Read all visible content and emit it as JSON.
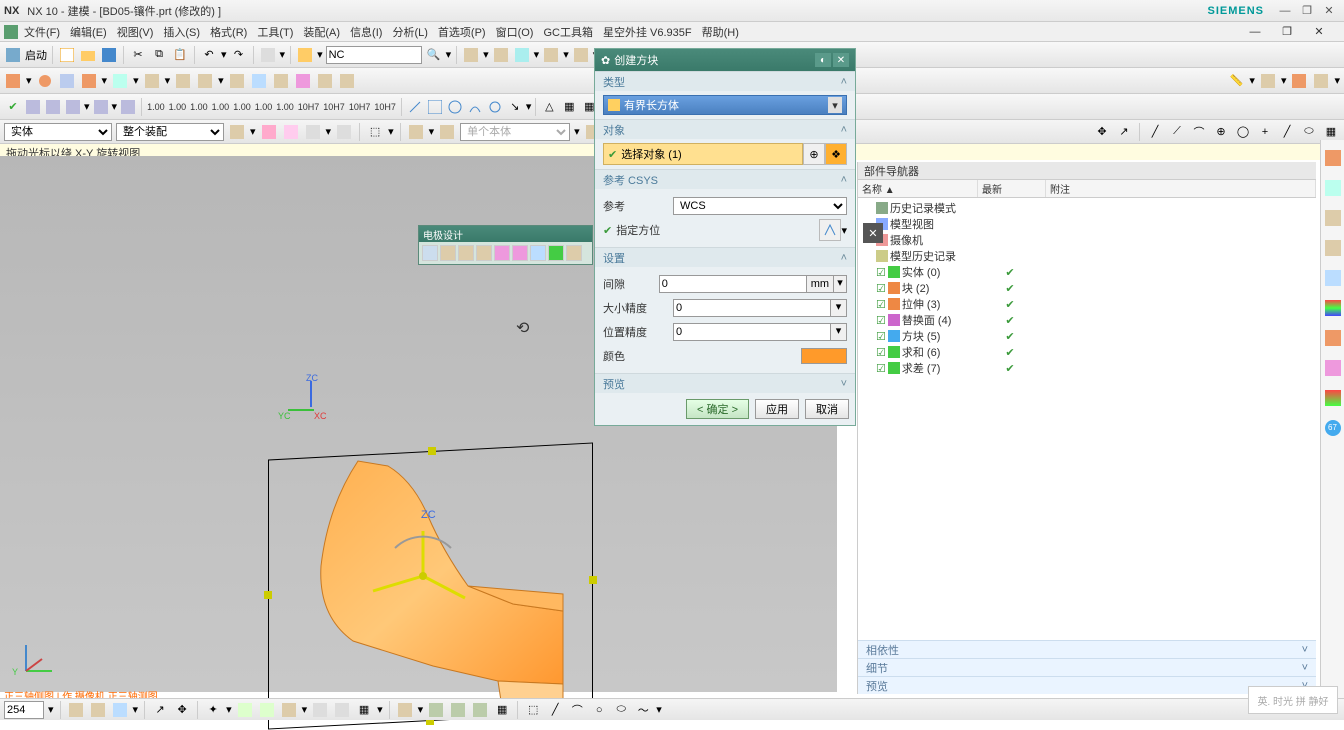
{
  "title": "NX 10 - 建模 - [BD05-镶件.prt  (修改的) ]",
  "brand": "SIEMENS",
  "menu": [
    "文件(F)",
    "编辑(E)",
    "视图(V)",
    "插入(S)",
    "格式(R)",
    "工具(T)",
    "装配(A)",
    "信息(I)",
    "分析(L)",
    "首选项(P)",
    "窗口(O)",
    "GC工具箱",
    "星空外挂 V6.935F",
    "帮助(H)"
  ],
  "tb1": {
    "start": "启动",
    "nc": "NC"
  },
  "tb3_nums": [
    "1.00",
    "1.00",
    "1.00",
    "1.00",
    "1.00",
    "1.00",
    "1.00",
    "10H7",
    "10H7",
    "10H7",
    "10H7"
  ],
  "filter": {
    "a": "实体",
    "b": "整个装配",
    "c": "单个本体"
  },
  "hint": "拖动光标以绕 X-Y 旋转视图",
  "mini_tb_title": "电极设计",
  "dialog": {
    "title": "创建方块",
    "s_type": "类型",
    "type_val": "有界长方体",
    "s_obj": "对象",
    "obj_val": "选择对象 (1)",
    "s_csys": "参考 CSYS",
    "ref_lbl": "参考",
    "ref_val": "WCS",
    "orient_lbl": "指定方位",
    "s_set": "设置",
    "gap_lbl": "间隙",
    "gap_val": "0",
    "gap_unit": "mm",
    "size_lbl": "大小精度",
    "size_val": "0",
    "pos_lbl": "位置精度",
    "pos_val": "0",
    "color_lbl": "颜色",
    "s_prev": "预览",
    "ok": "< 确定 >",
    "apply": "应用",
    "cancel": "取消"
  },
  "rpanel": {
    "title": "部件导航器",
    "cols": [
      "名称 ▲",
      "最新",
      "附注"
    ],
    "rows": [
      {
        "ind": 0,
        "label": "历史记录模式",
        "chk": false,
        "ico": "#8a8",
        "c2": ""
      },
      {
        "ind": 0,
        "label": "模型视图",
        "chk": false,
        "ico": "#8af",
        "c2": ""
      },
      {
        "ind": 0,
        "label": "摄像机",
        "chk": false,
        "ico": "#e99",
        "c2": ""
      },
      {
        "ind": 0,
        "label": "模型历史记录",
        "chk": false,
        "ico": "#cc8",
        "c2": ""
      },
      {
        "ind": 1,
        "label": "实体 (0)",
        "chk": true,
        "ico": "#4c4",
        "c2": "✔"
      },
      {
        "ind": 1,
        "label": "块 (2)",
        "chk": true,
        "ico": "#e84",
        "c2": "✔"
      },
      {
        "ind": 1,
        "label": "拉伸 (3)",
        "chk": true,
        "ico": "#e84",
        "c2": "✔"
      },
      {
        "ind": 1,
        "label": "替换面 (4)",
        "chk": true,
        "ico": "#c6c",
        "c2": "✔"
      },
      {
        "ind": 1,
        "label": "方块 (5)",
        "chk": true,
        "ico": "#4ae",
        "c2": "✔"
      },
      {
        "ind": 1,
        "label": "求和 (6)",
        "chk": true,
        "ico": "#4c4",
        "c2": "✔"
      },
      {
        "ind": 1,
        "label": "求差 (7)",
        "chk": true,
        "ico": "#4c4",
        "c2": "✔"
      }
    ],
    "acc": [
      "相依性",
      "细节",
      "预览"
    ]
  },
  "status_num": "254",
  "footnote": "正三轴侧图 | 作 摄像机 正三轴测图",
  "watermark": "英. 时光\n拼 静好",
  "chart_data": null
}
